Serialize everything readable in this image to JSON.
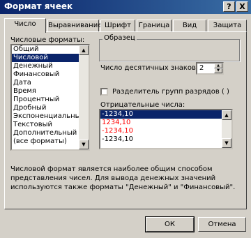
{
  "window": {
    "title": "Формат ячеек",
    "help_button": "?",
    "close_button": "X"
  },
  "tabs": [
    {
      "label": "Число",
      "active": true
    },
    {
      "label": "Выравнивание",
      "active": false
    },
    {
      "label": "Шрифт",
      "active": false
    },
    {
      "label": "Граница",
      "active": false
    },
    {
      "label": "Вид",
      "active": false
    },
    {
      "label": "Защита",
      "active": false
    }
  ],
  "formats": {
    "label": "Числовые форматы:",
    "items": [
      "Общий",
      "Числовой",
      "Денежный",
      "Финансовый",
      "Дата",
      "Время",
      "Процентный",
      "Дробный",
      "Экспоненциальный",
      "Текстовый",
      "Дополнительный",
      "(все форматы)"
    ],
    "selected_index": 1
  },
  "sample": {
    "label": "Образец",
    "value": ""
  },
  "decimals": {
    "label": "Число десятичных знаков:",
    "value": "2"
  },
  "separator": {
    "label": "Разделитель групп разрядов ( )",
    "checked": false
  },
  "negatives": {
    "label": "Отрицательные числа:",
    "items": [
      "-1234,10",
      "1234,10",
      "-1234,10",
      "-1234,10"
    ],
    "selected_index": 0,
    "red_indices": [
      1,
      2
    ]
  },
  "description": "Числовой формат является наиболее общим способом представления чисел. Для вывода денежных значений используются также форматы \"Денежный\" и \"Финансовый\".",
  "buttons": {
    "ok": "ОК",
    "cancel": "Отмена"
  },
  "colors": {
    "selection": "#0a246a",
    "negative_red": "#ff0000"
  }
}
